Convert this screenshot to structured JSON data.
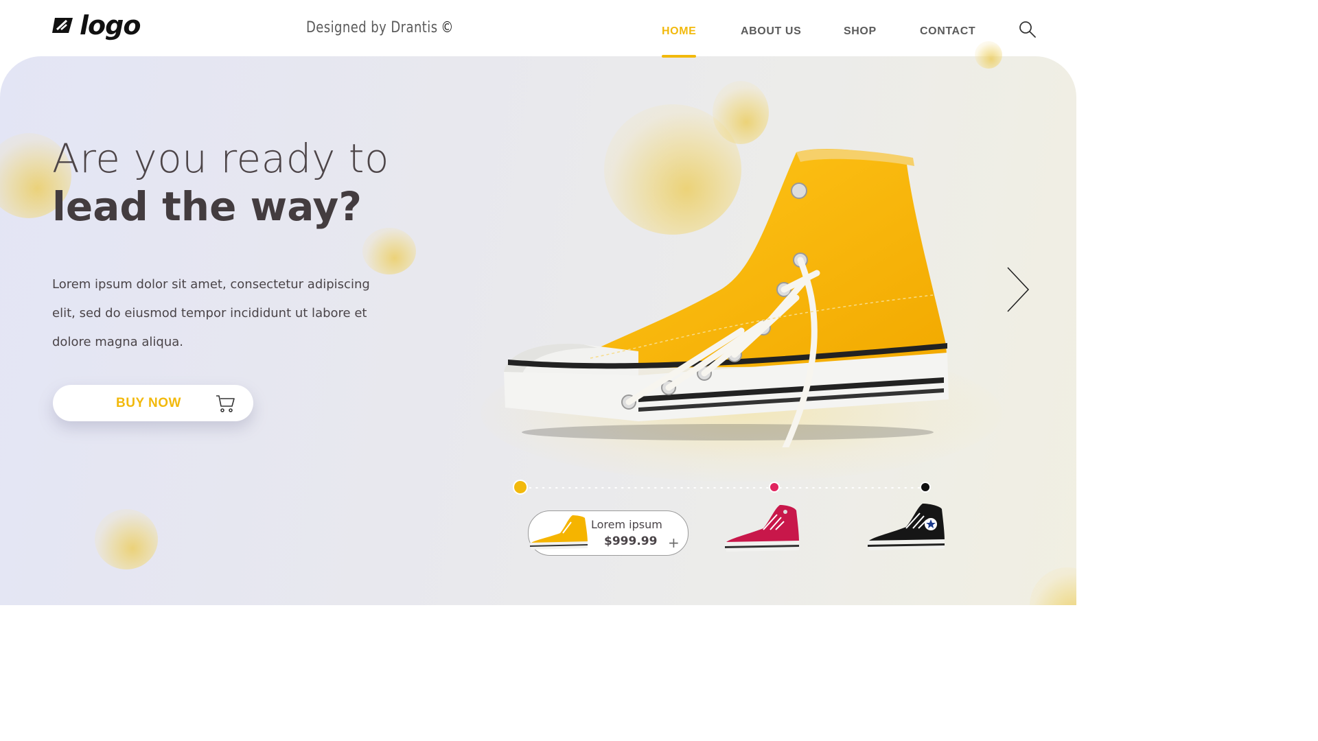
{
  "header": {
    "logo_text": "logo",
    "tagline": "Designed by Drantis",
    "tagline_symbol": "©",
    "nav": [
      {
        "label": "HOME",
        "active": true
      },
      {
        "label": "ABOUT US",
        "active": false
      },
      {
        "label": "SHOP",
        "active": false
      },
      {
        "label": "CONTACT",
        "active": false
      }
    ],
    "search_icon": "search-icon"
  },
  "hero": {
    "headline_light": "Are you ready to",
    "headline_bold": "lead the way?",
    "description": "Lorem ipsum dolor sit amet, consectetur adipiscing elit, sed do eiusmod tempor incididunt ut labore et dolore magna aliqua.",
    "buy_button": {
      "label": "BUY NOW",
      "icon": "cart-icon"
    },
    "next_icon": "chevron-right-icon"
  },
  "products": {
    "slider_dots": [
      {
        "color": "#f2b90c",
        "active": true
      },
      {
        "color": "#e0245e",
        "active": false
      },
      {
        "color": "#111111",
        "active": false
      }
    ],
    "selected": {
      "name": "Lorem ipsum",
      "price": "$999.99",
      "add_icon": "+"
    },
    "variants": [
      {
        "color": "#f5b400",
        "name": "yellow-sneaker"
      },
      {
        "color": "#c8174a",
        "name": "red-sneaker"
      },
      {
        "color": "#161616",
        "name": "black-sneaker"
      }
    ]
  },
  "colors": {
    "accent": "#f2b90c",
    "text_dark": "#433c3f"
  }
}
